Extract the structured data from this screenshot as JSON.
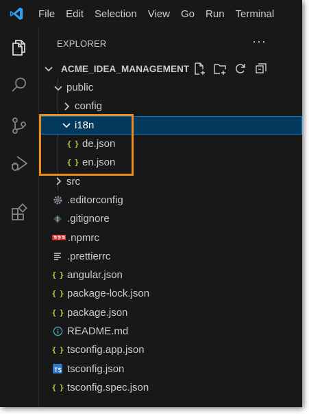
{
  "menubar": {
    "logo_icon": "vscode-logo-icon",
    "items": [
      "File",
      "Edit",
      "Selection",
      "View",
      "Go",
      "Run",
      "Terminal"
    ]
  },
  "activitybar": {
    "items": [
      {
        "name": "explorer",
        "icon": "files-icon",
        "active": true
      },
      {
        "name": "search",
        "icon": "search-icon",
        "active": false
      },
      {
        "name": "source-control",
        "icon": "source-control-icon",
        "active": false
      },
      {
        "name": "run-debug",
        "icon": "run-debug-icon",
        "active": false
      },
      {
        "name": "extensions",
        "icon": "extensions-icon",
        "active": false
      }
    ]
  },
  "explorer": {
    "title": "EXPLORER",
    "more_label": "···",
    "root": {
      "label": "ACME_IDEA_MANAGEMENT",
      "actions": [
        "new-file-icon",
        "new-folder-icon",
        "refresh-icon",
        "collapse-all-icon"
      ]
    },
    "tree": {
      "public": {
        "label": "public"
      },
      "config": {
        "label": "config"
      },
      "i18n": {
        "label": "i18n"
      },
      "de_json": {
        "label": "de.json"
      },
      "en_json": {
        "label": "en.json"
      },
      "src": {
        "label": "src"
      },
      "editorconfig": {
        "label": ".editorconfig"
      },
      "gitignore": {
        "label": ".gitignore"
      },
      "npmrc": {
        "label": ".npmrc",
        "badge": "npm"
      },
      "prettierrc": {
        "label": ".prettierrc"
      },
      "angular_json": {
        "label": "angular.json"
      },
      "package_lock_json": {
        "label": "package-lock.json"
      },
      "package_json": {
        "label": "package.json"
      },
      "readme": {
        "label": "README.md"
      },
      "tsconfig_app": {
        "label": "tsconfig.app.json"
      },
      "tsconfig": {
        "label": "tsconfig.json",
        "badge": "TS"
      },
      "tsconfig_spec": {
        "label": "tsconfig.spec.json"
      }
    }
  },
  "colors": {
    "background": "#181818",
    "text": "#cccccc",
    "selection_bg": "#04395e",
    "selection_border": "#0078d4",
    "json_icon": "#cbcb41",
    "annotation": "#f08a19",
    "npm": "#cb3837",
    "ts": "#3178c6"
  }
}
